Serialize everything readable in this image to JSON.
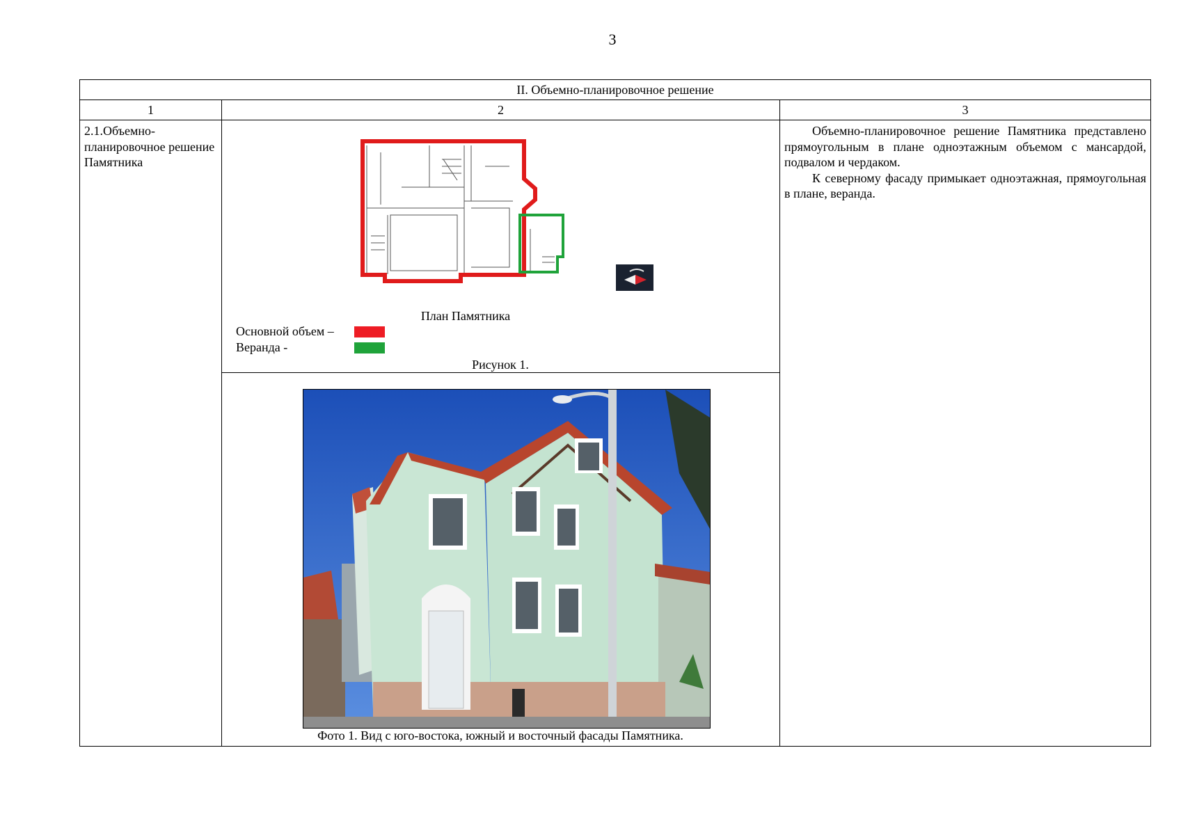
{
  "page_number": "3",
  "section_title": "II. Объемно-планировочное решение",
  "column_headers": [
    "1",
    "2",
    "3"
  ],
  "row": {
    "parameter": "2.1.Объемно-планировочное решение Памятника",
    "figure": {
      "plan_caption": "План Памятника",
      "legend": [
        {
          "label": "Основной объем –",
          "color": "#ee1c24"
        },
        {
          "label": "Веранда -",
          "color": "#1fa33a"
        }
      ],
      "figure_label": "Рисунок 1.",
      "plan_outline_main_color": "#e01b1b",
      "plan_outline_veranda_color": "#1fa33a"
    },
    "photo_caption": "Фото 1. Вид с  юго-востока, южный и восточный фасады Памятника.",
    "description": [
      "Объемно-планировочное решение Памятника представлено прямоугольным в плане одноэтажным объемом с мансардой, подвалом и чердаком.",
      "К северному фасаду примыкает одноэтажная, прямоугольная в плане, веранда."
    ]
  }
}
